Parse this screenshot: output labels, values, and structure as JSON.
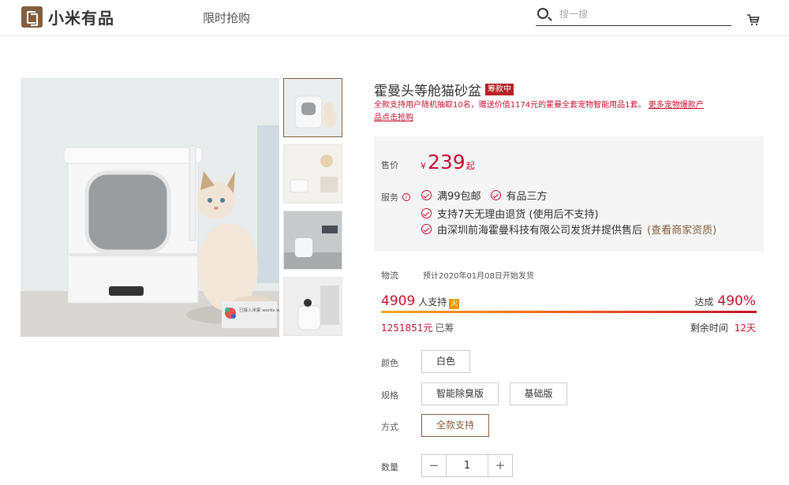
{
  "header": {
    "logo_text": "小米有品",
    "nav_flash_sale": "限时抢购",
    "search_placeholder": "搜一搜"
  },
  "product": {
    "title": "霍曼头等舱猫砂盆",
    "status_badge": "筹款中",
    "promo_text": "全款支持用户随机抽取10名，赠送价值1174元的霍曼全套宠物智能用品1套。",
    "promo_link": "更多宠物爆款产品点击抢购",
    "image_label": "已接入米家 works with mijia"
  },
  "price": {
    "label": "售价",
    "currency": "¥",
    "amount": "239",
    "suffix": "起"
  },
  "service": {
    "label": "服务",
    "items_row1": [
      "满99包邮",
      "有品三方"
    ],
    "item_row2": "支持7天无理由退货 (使用后不支持)",
    "item_row3": "由深圳前海霍曼科技有限公司发货并提供售后",
    "merchant_link": "(查看商家资质)"
  },
  "shipping": {
    "label": "物流",
    "text": "预计2020年01月08日开始发货"
  },
  "crowdfunding": {
    "backers": "4909",
    "backers_label": "人支持",
    "hot_tag": "火",
    "reached_label": "达成",
    "reached_percent": "490%",
    "progress": 4.9,
    "raised": "1251851元",
    "raised_label": "已筹",
    "remaining_label": "剩余时间",
    "remaining": "12天"
  },
  "options": {
    "color_label": "颜色",
    "color_options": [
      "白色"
    ],
    "spec_label": "规格",
    "spec_options": [
      "智能除臭版",
      "基础版"
    ],
    "mode_label": "方式",
    "mode_options": [
      "全款支持"
    ],
    "mode_selected": "全款支持"
  },
  "quantity": {
    "label": "数量",
    "minus": "−",
    "value": "1",
    "plus": "+"
  },
  "colors": {
    "brand": "#845f3f",
    "accent_red": "#c8102e"
  }
}
